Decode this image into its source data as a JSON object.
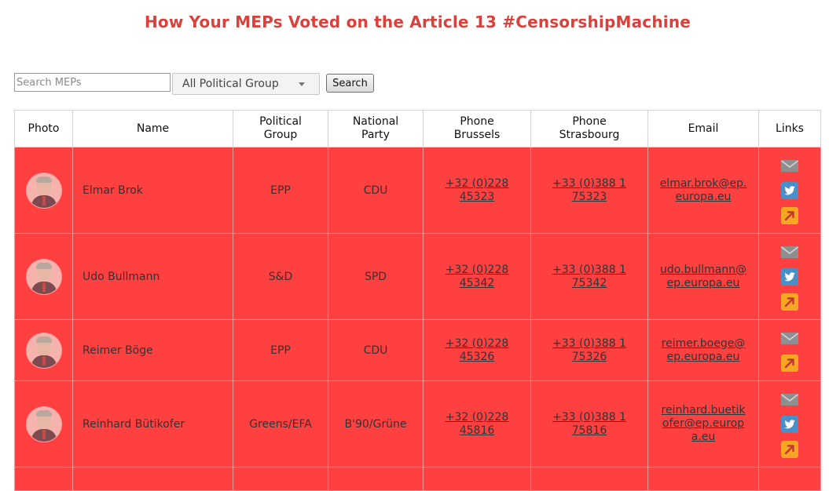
{
  "title": "How Your MEPs Voted on the Article 13 #CensorshipMachine",
  "search": {
    "placeholder": "Search MEPs",
    "value": ""
  },
  "group_filter": {
    "selected": "All Political Group"
  },
  "search_button": "Search",
  "table": {
    "headers": {
      "photo": "Photo",
      "name": "Name",
      "group_line1": "Political",
      "group_line2": "Group",
      "party_line1": "National",
      "party_line2": "Party",
      "brussels_line1": "Phone",
      "brussels_line2": "Brussels",
      "strasbourg_line1": "Phone",
      "strasbourg_line2": "Strasbourg",
      "email": "Email",
      "links": "Links"
    },
    "rows": [
      {
        "name": "Elmar Brok",
        "group": "EPP",
        "party": "CDU",
        "brussels_1": "+32 (0)228",
        "brussels_2": "45323",
        "strasbourg_1": "+33 (0)388 1",
        "strasbourg_2": "75323",
        "email_lines": [
          "elmar.brok@ep.",
          "europa.eu"
        ],
        "links": [
          "email-icon",
          "twitter-icon",
          "external-link-icon"
        ]
      },
      {
        "name": "Udo Bullmann",
        "group": "S&D",
        "party": "SPD",
        "brussels_1": "+32 (0)228",
        "brussels_2": "45342",
        "strasbourg_1": "+33 (0)388 1",
        "strasbourg_2": "75342",
        "email_lines": [
          "udo.bullmann@",
          "ep.europa.eu"
        ],
        "links": [
          "email-icon",
          "twitter-icon",
          "external-link-icon"
        ]
      },
      {
        "name": "Reimer Böge",
        "group": "EPP",
        "party": "CDU",
        "brussels_1": "+32 (0)228",
        "brussels_2": "45326",
        "strasbourg_1": "+33 (0)388 1",
        "strasbourg_2": "75326",
        "email_lines": [
          "reimer.boege@",
          "ep.europa.eu"
        ],
        "links": [
          "email-icon",
          "external-link-icon"
        ]
      },
      {
        "name": "Reinhard Bütikofer",
        "group": "Greens/EFA",
        "party": "B'90/Grüne",
        "brussels_1": "+32 (0)228",
        "brussels_2": "45816",
        "strasbourg_1": "+33 (0)388 1",
        "strasbourg_2": "75816",
        "email_lines": [
          "reinhard.buetik",
          "ofer@ep.europ",
          "a.eu"
        ],
        "links": [
          "email-icon",
          "twitter-icon",
          "external-link-icon"
        ]
      }
    ]
  },
  "colors": {
    "title": "#d9413c",
    "row_background": "#fe4040",
    "email_icon": "#8f8f8f",
    "twitter_icon": "#4a90c8",
    "link_icon": "#f5a623"
  }
}
